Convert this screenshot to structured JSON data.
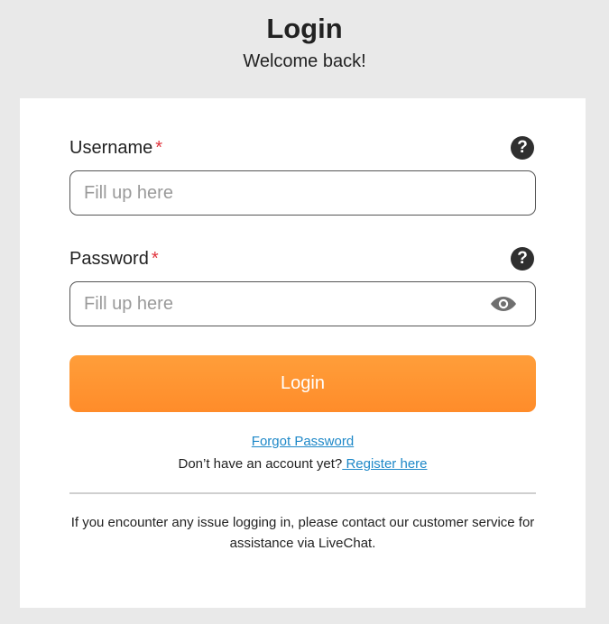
{
  "header": {
    "title": "Login",
    "subtitle": "Welcome back!"
  },
  "form": {
    "username": {
      "label": "Username",
      "required_mark": "*",
      "help_icon": "question-circle-icon",
      "help_glyph": "?",
      "placeholder": "Fill up here",
      "value": ""
    },
    "password": {
      "label": "Password",
      "required_mark": "*",
      "help_icon": "question-circle-icon",
      "help_glyph": "?",
      "placeholder": "Fill up here",
      "value": "",
      "toggle_icon": "eye-icon"
    },
    "login_label": "Login"
  },
  "links": {
    "forgot_password": "Forgot Password",
    "no_account_text": "Don’t have an account yet?",
    "register": " Register here"
  },
  "footer": {
    "note": "If you encounter any issue logging in, please contact our customer service for assistance via LiveChat."
  },
  "colors": {
    "background": "#e9e9e9",
    "card": "#ffffff",
    "accent": "#ff9433",
    "required": "#e0333c",
    "link": "#1e88c8"
  }
}
